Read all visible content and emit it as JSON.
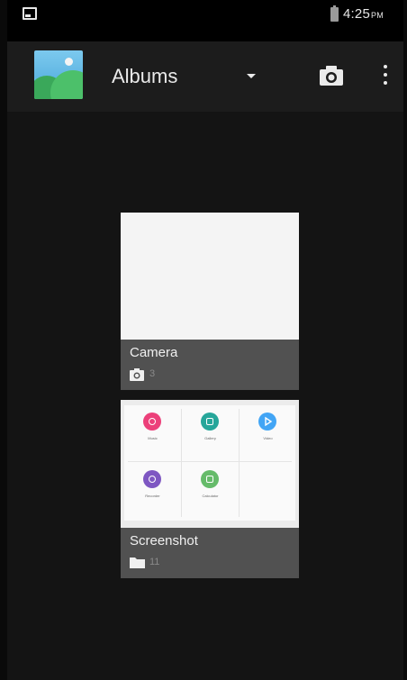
{
  "status_bar": {
    "time": "4:25",
    "ampm": "PM"
  },
  "toolbar": {
    "spinner_label": "Albums",
    "icons": [
      "gallery-app-icon",
      "dropdown-arrow-icon",
      "camera-icon",
      "overflow-menu-icon"
    ]
  },
  "albums": [
    {
      "name": "Camera",
      "count": "3",
      "type_icon": "camera-icon"
    },
    {
      "name": "Screenshot",
      "count": "11",
      "type_icon": "folder-icon"
    }
  ],
  "screenshot_thumb": {
    "apps": [
      {
        "label": "Music",
        "color": "#ec407a",
        "icon": "music-icon"
      },
      {
        "label": "Gallery",
        "color": "#26a69a",
        "icon": "image-icon"
      },
      {
        "label": "Video",
        "color": "#42a5f5",
        "icon": "play-icon"
      },
      {
        "label": "Recorder",
        "color": "#7e57c2",
        "icon": "mic-icon"
      },
      {
        "label": "Calculator",
        "color": "#66bb6a",
        "icon": "calculator-icon"
      }
    ]
  },
  "colors": {
    "background": "#141414",
    "toolbar": "#1c1c1c",
    "caption": "#515151"
  }
}
